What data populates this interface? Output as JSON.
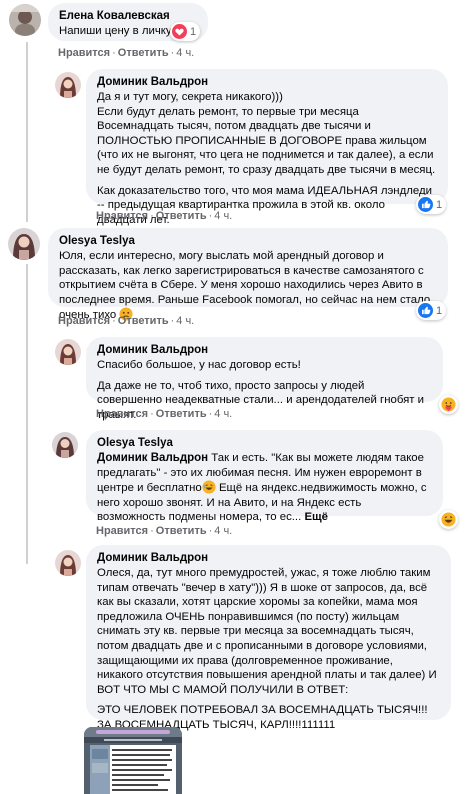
{
  "labels": {
    "like": "Нравится",
    "reply": "Ответить",
    "dot": "·"
  },
  "comments": [
    {
      "author": "Елена Ковалевская",
      "text": "Напиши цену в личку",
      "time": "4 ч.",
      "reactions": {
        "count": "1",
        "type": "love"
      }
    },
    {
      "author": "Доминик Вальдрон",
      "paragraphs": [
        "Да я и тут могу, секрета никакого)))\nЕсли будут делать ремонт, то первые три месяца Восемнадцать тысяч, потом двадцать две тысячи и ПОЛНОСТЬЮ ПРОПИСАННЫЕ В ДОГОВОРЕ права жильцом (что их не выгонят, что цега не поднимется и так далее), а если не будут делать ремонт, то сразу двадцать две тысячи в месяц.",
        "Как доказательство того, что моя мама ИДЕАЛЬНАЯ лэндледи -- предыдущая квартирантка прожила в этой кв. около двадцати лет."
      ],
      "time": "4 ч.",
      "reactions": {
        "count": "1",
        "type": "like"
      }
    },
    {
      "author": "Olesya Teslya",
      "text": "Юля, если интересно, могу выслать мой арендный договор и рассказать, как легко зарегистрироваться в качестве самозанятого с открытием счёта в Сбере. У меня хорошо находились через Авито в последнее время. Раньше Facebook помогал, но сейчас на нем стало очень тихо",
      "time": "4 ч.",
      "reactions": {
        "count": "1",
        "type": "like"
      }
    },
    {
      "author": "Доминик Вальдрон",
      "paragraphs": [
        "Спасибо большое, у нас договор есть!",
        "Да даже не то, чтоб тихо, просто запросы у людей совершенно неадекватные стали... и арендодателей гнобят и траыят."
      ],
      "time": "4 ч.",
      "reactions": {
        "type": "care"
      }
    },
    {
      "author": "Olesya Teslya",
      "mention": "Доминик Вальдрон",
      "text_a": " Так и есть. \"Как вы можете людям такое предлагать\" - это их любимая песня. Им нужен евроремонт в центре и бесплатно",
      "text_b": " Ещё на яндекс.недвижимость можно, с него хорошо звонят. И на Авито, и на Яндекс есть возможность подмены номера, то ес...",
      "more": "Ещё",
      "time": "4 ч.",
      "reactions": {
        "type": "haha"
      }
    },
    {
      "author": "Доминик Вальдрон",
      "paragraphs": [
        "Олеся, да, тут много премудростей, ужас, я тоже люблю таким типам отвечать \"вечер в хату\"))) Я в шоке от запросов, да, всё как вы сказали, хотят царские хоромы за копейки, мама моя предложила ОЧЕНЬ понравившимся (по посту) жильцам снимать эту кв. первые три месяца за восемнадцать тысяч, потом двадцать две и с прописанными в договоре условиями, защищающими их права (долговременное проживание, никакого отсутствия повышения арендной платы и так далее) И ВОТ ЧТО МЫ С МАМОЙ ПОЛУЧИЛИ В ОТВЕТ:",
        "ЭТО ЧЕЛОВЕК ПОТРЕБОВАЛ ЗА ВОСЕМНАДЦАТЬ ТЫСЯЧ!!! ЗА ВОСЕМНАДЦАТЬ ТЫСЯЧ, КАРЛ!!!!111111"
      ]
    }
  ],
  "colors": {
    "bubble": "#f0f2f5",
    "meta": "#65676b",
    "like_blue": "#1877f2",
    "love_red": "#f33e58",
    "emoji_yellow": "#f7b125"
  },
  "icons": [
    "love-reaction-icon",
    "like-reaction-icon",
    "care-reaction-icon",
    "haha-reaction-icon",
    "sad-emoji-icon",
    "laugh-emoji-icon"
  ]
}
